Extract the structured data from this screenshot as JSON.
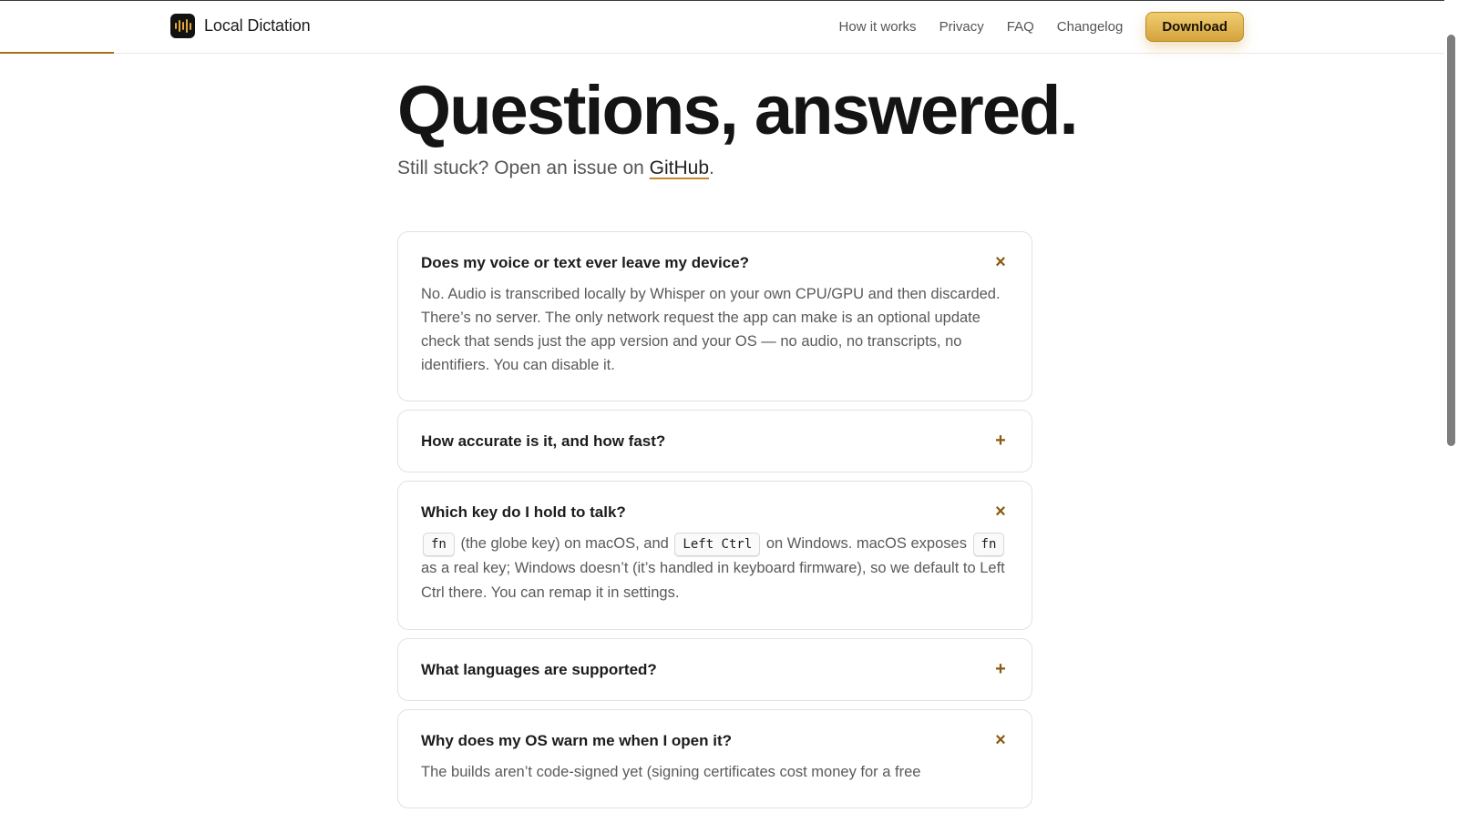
{
  "header": {
    "brand": "Local Dictation",
    "nav": [
      "How it works",
      "Privacy",
      "FAQ",
      "Changelog"
    ],
    "download_label": "Download"
  },
  "page": {
    "title": "Questions, answered.",
    "subtitle_prefix": "Still stuck? Open an issue on ",
    "subtitle_link": "GitHub",
    "subtitle_suffix": "."
  },
  "faq": [
    {
      "question": "Does my voice or text ever leave my device?",
      "toggle": "×",
      "answer": "No. Audio is transcribed locally by Whisper on your own CPU/GPU and then discarded. There’s no server. The only network request the app can make is an optional update check that sends just the app version and your OS — no audio, no transcripts, no identifiers. You can disable it."
    },
    {
      "question": "How accurate is it, and how fast?",
      "toggle": "+"
    },
    {
      "question": "Which key do I hold to talk?",
      "toggle": "×",
      "answer_parts": {
        "key1": "fn",
        "text1": " (the globe key) on macOS, and ",
        "key2": "Left Ctrl",
        "text2": " on Windows. macOS exposes ",
        "key3": "fn",
        "text3": " as a real key; Windows doesn’t (it’s handled in keyboard firmware), so we default to Left Ctrl there. You can remap it in settings."
      }
    },
    {
      "question": "What languages are supported?",
      "toggle": "+"
    },
    {
      "question": "Why does my OS warn me when I open it?",
      "toggle": "×",
      "answer": "The builds aren’t code-signed yet (signing certificates cost money for a free"
    }
  ],
  "colors": {
    "accent": "#a9701a",
    "button_gradient_top": "#f0cd70",
    "button_gradient_bottom": "#d5a33e",
    "toggle": "#8a5a12"
  }
}
